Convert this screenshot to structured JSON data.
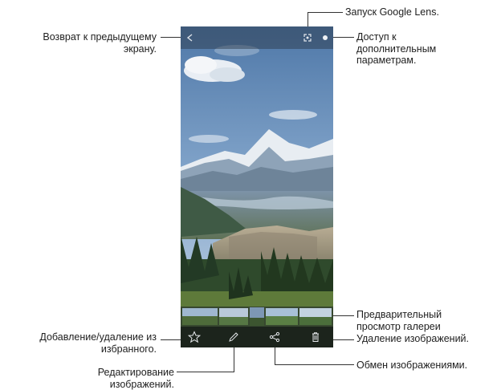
{
  "callouts": {
    "lens": "Запуск Google Lens.",
    "back": "Возврат к предыдущему\nэкрану.",
    "more": "Доступ к\nдополнительным\nпараметрам.",
    "preview": "Предварительный\nпросмотр галереи",
    "favorite": "Добавление/удаление из\nизбранного.",
    "delete": "Удаление изображений.",
    "edit": "Редактирование\nизображений.",
    "share": "Обмен изображениями."
  },
  "icons": {
    "back": "back-arrow-icon",
    "lens": "google-lens-icon",
    "more": "more-options-icon",
    "favorite": "star-icon",
    "edit": "pencil-icon",
    "share": "share-icon",
    "delete": "trash-icon"
  },
  "colors": {
    "sky": "#6c8db5",
    "bars": "#1c241c"
  }
}
